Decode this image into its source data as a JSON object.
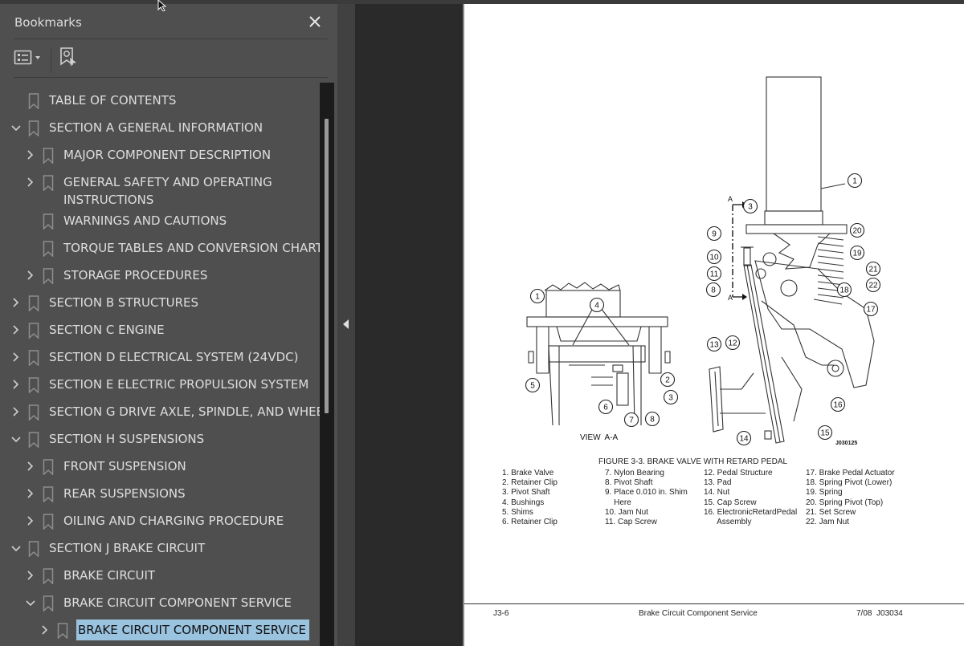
{
  "bookmarks_panel": {
    "title": "Bookmarks",
    "close_icon": "close-icon",
    "toolbar": {
      "options_icon": "list-options-icon",
      "find_icon": "find-current-bookmark-icon"
    },
    "items": [
      {
        "label": "TABLE OF CONTENTS",
        "level": 0,
        "expander": "none"
      },
      {
        "label": "SECTION A GENERAL INFORMATION",
        "level": 0,
        "expander": "expanded"
      },
      {
        "label": "MAJOR COMPONENT DESCRIPTION",
        "level": 1,
        "expander": "collapsed"
      },
      {
        "label": "GENERAL SAFETY AND OPERATING",
        "label_line2": "INSTRUCTIONS",
        "level": 1,
        "expander": "collapsed"
      },
      {
        "label": "WARNINGS AND CAUTIONS",
        "level": 1,
        "expander": "none"
      },
      {
        "label": "TORQUE TABLES AND CONVERSION CHARTS",
        "level": 1,
        "expander": "none"
      },
      {
        "label": "STORAGE PROCEDURES",
        "level": 1,
        "expander": "collapsed"
      },
      {
        "label": "SECTION B STRUCTURES",
        "level": 0,
        "expander": "collapsed"
      },
      {
        "label": "SECTION C ENGINE",
        "level": 0,
        "expander": "collapsed"
      },
      {
        "label": "SECTION D ELECTRICAL SYSTEM (24VDC)",
        "level": 0,
        "expander": "collapsed"
      },
      {
        "label": "SECTION E ELECTRIC PROPULSION SYSTEM",
        "level": 0,
        "expander": "collapsed"
      },
      {
        "label": "SECTION G DRIVE AXLE, SPINDLE, AND WHEELS",
        "level": 0,
        "expander": "collapsed"
      },
      {
        "label": "SECTION H SUSPENSIONS",
        "level": 0,
        "expander": "expanded"
      },
      {
        "label": "FRONT SUSPENSION",
        "level": 1,
        "expander": "collapsed"
      },
      {
        "label": "REAR SUSPENSIONS",
        "level": 1,
        "expander": "collapsed"
      },
      {
        "label": "OILING AND CHARGING PROCEDURE",
        "level": 1,
        "expander": "collapsed"
      },
      {
        "label": "SECTION J BRAKE CIRCUIT",
        "level": 0,
        "expander": "expanded"
      },
      {
        "label": "BRAKE CIRCUIT",
        "level": 1,
        "expander": "collapsed"
      },
      {
        "label": "BRAKE CIRCUIT COMPONENT SERVICE",
        "level": 1,
        "expander": "expanded"
      },
      {
        "label": "BRAKE CIRCUIT COMPONENT SERVICE",
        "level": 2,
        "expander": "collapsed",
        "selected": true
      }
    ],
    "selected_color": "#9ac3e0"
  },
  "splitter": {
    "toggle_icon": "collapse-panel-left-icon"
  },
  "document_page": {
    "figure_caption": "FIGURE 3-3. BRAKE VALVE WITH RETARD PEDAL",
    "view_label": "VIEW  A-A",
    "section_marker": "A",
    "drawing_id": "J030125",
    "callouts_view_aa": [
      "1",
      "2",
      "3",
      "4",
      "5",
      "6",
      "7",
      "8"
    ],
    "callouts_main": [
      "1",
      "3",
      "8",
      "9",
      "10",
      "11",
      "12",
      "13",
      "14",
      "15",
      "16",
      "17",
      "18",
      "19",
      "20",
      "21",
      "22"
    ],
    "legend_columns": [
      [
        "1. Brake Valve",
        "2. Retainer Clip",
        "3. Pivot Shaft",
        "4. Bushings",
        "5. Shims",
        "6. Retainer Clip"
      ],
      [
        "7. Nylon Bearing",
        "8. Pivot Shaft",
        "9. Place 0.010 in. Shim",
        "    Here",
        "10. Jam Nut",
        "11. Cap Screw"
      ],
      [
        "12. Pedal Structure",
        "13. Pad",
        "14. Nut",
        "15. Cap Screw",
        "16. ElectronicRetardPedal",
        "      Assembly"
      ],
      [
        "17. Brake Pedal Actuator",
        "18. Spring Pivot (Lower)",
        "19. Spring",
        "20. Spring Pivot (Top)",
        "21. Set Screw",
        "22. Jam Nut"
      ]
    ],
    "footer": {
      "page_number": "J3-6",
      "title": "Brake Circuit Component Service",
      "revision": "7/08  J03034"
    }
  }
}
